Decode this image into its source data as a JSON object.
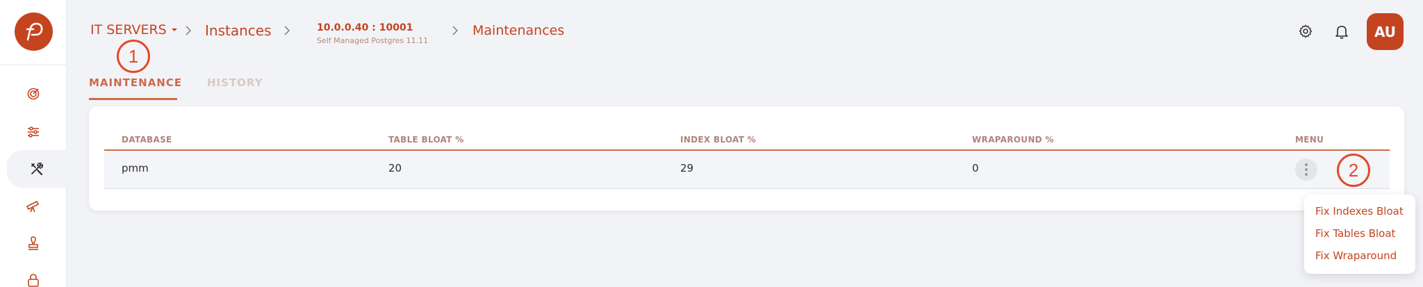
{
  "brand": {
    "accent": "#c4441f",
    "marker": "#e04a28"
  },
  "breadcrumb": {
    "root": "IT SERVERS",
    "instances": "Instances",
    "instance_address": "10.0.0.40 : 10001",
    "instance_subtitle": "Self Managed Postgres 11.11",
    "page": "Maintenances"
  },
  "header": {
    "settings_icon": "gear-icon",
    "notifications_icon": "bell-icon",
    "avatar_initials": "AU"
  },
  "sidebar": {
    "items": [
      {
        "icon": "target-icon"
      },
      {
        "icon": "sliders-icon"
      },
      {
        "icon": "tools-icon",
        "active": true
      },
      {
        "icon": "telescope-icon"
      },
      {
        "icon": "stamp-icon"
      },
      {
        "icon": "lock-icon"
      }
    ]
  },
  "tabs": [
    {
      "label": "MAINTENANCE",
      "active": true
    },
    {
      "label": "HISTORY",
      "active": false
    }
  ],
  "table": {
    "columns": [
      "DATABASE",
      "TABLE BLOAT %",
      "INDEX BLOAT %",
      "WRAPAROUND %",
      "MENU"
    ],
    "rows": [
      {
        "database": "pmm",
        "table_bloat": "20",
        "index_bloat": "29",
        "wraparound": "0"
      }
    ]
  },
  "row_menu": {
    "items": [
      "Fix Indexes Bloat",
      "Fix Tables Bloat",
      "Fix Wraparound"
    ]
  },
  "markers": [
    "1",
    "2"
  ]
}
